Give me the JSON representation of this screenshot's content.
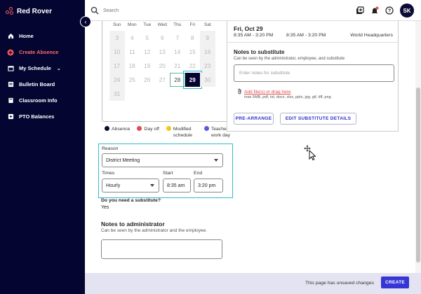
{
  "app": {
    "brand": "Red Rover"
  },
  "sidebar": {
    "items": [
      {
        "label": "Home",
        "icon": "home-icon"
      },
      {
        "label": "Create Absence",
        "icon": "plus-circle-icon",
        "active": true
      },
      {
        "label": "My Schedule",
        "icon": "calendar-icon"
      },
      {
        "label": "Bulletin Board",
        "icon": "bulletin-icon"
      },
      {
        "label": "Classroom Info",
        "icon": "book-icon"
      },
      {
        "label": "PTO Balances",
        "icon": "balance-icon"
      }
    ]
  },
  "topbar": {
    "search_placeholder": "Search",
    "avatar_initials": "SK"
  },
  "calendar": {
    "weekdays": [
      "Sun",
      "Mon",
      "Tue",
      "Wed",
      "Thu",
      "Fri",
      "Sat"
    ],
    "weeks": [
      [
        "3",
        "4",
        "5",
        "6",
        "7",
        "8",
        "9"
      ],
      [
        "10",
        "11",
        "12",
        "13",
        "14",
        "15",
        "16"
      ],
      [
        "17",
        "18",
        "19",
        "20",
        "21",
        "22",
        "23"
      ],
      [
        "24",
        "25",
        "26",
        "27",
        "28",
        "29",
        "30"
      ],
      [
        "31",
        "",
        "",
        "",
        "",
        "",
        ""
      ]
    ],
    "selected_day": "29",
    "outlined_day": "28"
  },
  "legend": [
    {
      "label": "Absence",
      "color": "#0b0b35"
    },
    {
      "label": "Day off",
      "color": "#e5484d"
    },
    {
      "label": "Modified schedule",
      "color": "#f5c518"
    },
    {
      "label": "Teacher work day",
      "color": "#5b5be0"
    }
  ],
  "form": {
    "reason_label": "Reason",
    "reason_value": "District Meeting",
    "times_label": "Times",
    "times_value": "Hourly",
    "start_label": "Start",
    "start_value": "8:35 am",
    "end_label": "End",
    "end_value": "3:20 pm",
    "substitute_question": "Do you need a substitute?",
    "substitute_answer": "Yes",
    "notes_admin_title": "Notes to administrator",
    "notes_admin_desc": "Can be seen by the administrator and the employee."
  },
  "detail": {
    "date": "Fri, Oct 29",
    "time": "8:35 AM - 3:20 PM",
    "time2": "8:35 AM - 3:20 PM",
    "location": "World Headquarters",
    "notes_sub_title": "Notes to substitute",
    "notes_sub_desc": "Can be seen by the administrator, employee, and substitute",
    "notes_sub_placeholder": "Enter notes for substitute",
    "attach_label": "Add file(s) or drag here",
    "attach_note": "max 5MB, pdf, txt, docx, xlsx, pptx, jpg, gif, tiff, png",
    "pre_arrange": "PRE-ARRANGE",
    "edit_details": "EDIT SUBSTITUTE DETAILS"
  },
  "footer": {
    "unsaved": "This page has unsaved changes",
    "create": "CREATE"
  }
}
